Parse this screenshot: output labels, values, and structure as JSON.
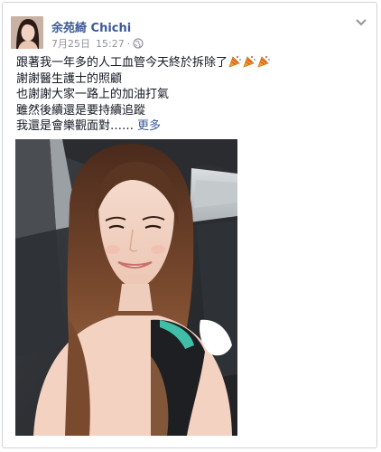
{
  "post": {
    "author_name": "余苑綺 Chichi",
    "date": "7月25日",
    "time": "15:27",
    "separator": "·",
    "privacy_icon": "globe-icon",
    "menu_icon": "chevron-down-icon",
    "text_lines": [
      "跟著我一年多的人工血管今天終於拆除了",
      "謝謝醫生護士的照顧",
      "也謝謝大家一路上的加油打氣",
      "雖然後續還是要持續追蹤",
      "我還是會樂觀面對……"
    ],
    "emoji_icon": "party-popper-icon",
    "more_label": "更多"
  },
  "colors": {
    "link": "#3b5998",
    "meta": "#90949c",
    "text": "#141823",
    "border": "#cfd3da"
  }
}
